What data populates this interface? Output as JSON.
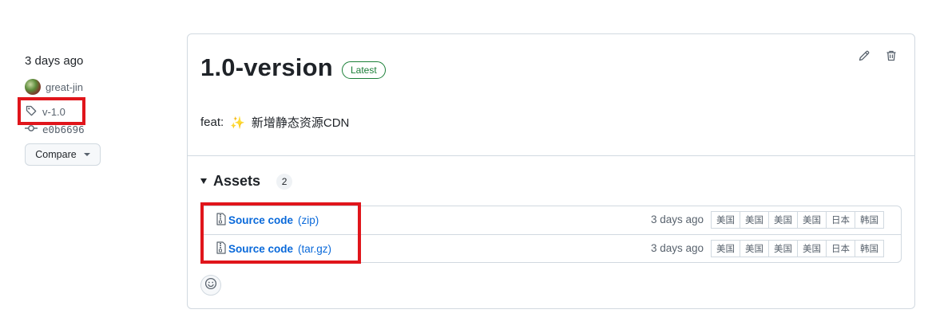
{
  "sidebar": {
    "date": "3 days ago",
    "author": "great-jin",
    "tag": "v-1.0",
    "commit": "e0b6696",
    "compare_label": "Compare"
  },
  "release": {
    "title": "1.0-version",
    "badge": "Latest",
    "notes_prefix": "feat:",
    "notes_emoji": "✨",
    "notes_text": "新增静态资源CDN"
  },
  "assets": {
    "label": "Assets",
    "count": "2",
    "items": [
      {
        "name": "Source code",
        "ext": "(zip)",
        "date": "3 days ago",
        "mirrors": [
          "美国",
          "美国",
          "美国",
          "美国",
          "日本",
          "韩国"
        ]
      },
      {
        "name": "Source code",
        "ext": "(tar.gz)",
        "date": "3 days ago",
        "mirrors": [
          "美国",
          "美国",
          "美国",
          "美国",
          "日本",
          "韩国"
        ]
      }
    ]
  },
  "colors": {
    "highlight": "#e0151b",
    "link": "#0969da",
    "latest": "#1a7f37"
  },
  "icons": [
    "tag-icon",
    "commit-icon",
    "pencil-icon",
    "trash-icon",
    "file-zip-icon",
    "smiley-icon"
  ]
}
